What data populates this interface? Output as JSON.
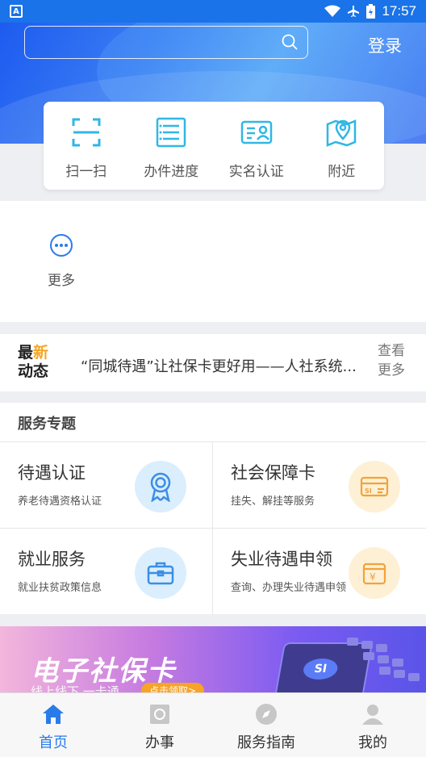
{
  "status_bar": {
    "time": "17:57",
    "left_icon_letter": "A"
  },
  "header": {
    "login_label": "登录",
    "search": {
      "value": "",
      "placeholder": ""
    }
  },
  "quick_actions": [
    {
      "label": "扫一扫",
      "icon": "scan-icon"
    },
    {
      "label": "办件进度",
      "icon": "progress-list-icon"
    },
    {
      "label": "实名认证",
      "icon": "id-card-icon"
    },
    {
      "label": "附近",
      "icon": "map-pin-icon"
    }
  ],
  "more": {
    "label": "更多",
    "icon": "more-dots-icon"
  },
  "news": {
    "tag_line1": "最新",
    "tag_line2": "动态",
    "text": "“同城待遇”让社保卡更好用——人社系统...",
    "see_more_line1": "查看",
    "see_more_line2": "更多"
  },
  "topics": {
    "title": "服务专题",
    "items": [
      {
        "title": "待遇认证",
        "subtitle": "养老待遇资格认证",
        "icon": "medal-icon",
        "color": "#dbeefd"
      },
      {
        "title": "社会保障卡",
        "subtitle": "挂失、解挂等服务",
        "icon": "si-card-icon",
        "color": "#fdf0d5"
      },
      {
        "title": "就业服务",
        "subtitle": "就业扶贫政策信息",
        "icon": "briefcase-icon",
        "color": "#dbeefd"
      },
      {
        "title": "失业待遇申领",
        "subtitle": "查询、办理失业待遇申领",
        "icon": "yen-card-icon",
        "color": "#fdf0d5"
      }
    ]
  },
  "banner": {
    "title": "电子社保卡",
    "subtitle": "线上线下 一卡通",
    "button": "点击领取>",
    "card_text": "SI"
  },
  "bottom_nav": [
    {
      "label": "首页",
      "icon": "home-icon",
      "active": true
    },
    {
      "label": "办事",
      "icon": "tasks-icon",
      "active": false
    },
    {
      "label": "服务指南",
      "icon": "compass-icon",
      "active": false
    },
    {
      "label": "我的",
      "icon": "user-icon",
      "active": false
    }
  ],
  "colors": {
    "primary": "#2a7bea",
    "accent": "#f5a623"
  }
}
